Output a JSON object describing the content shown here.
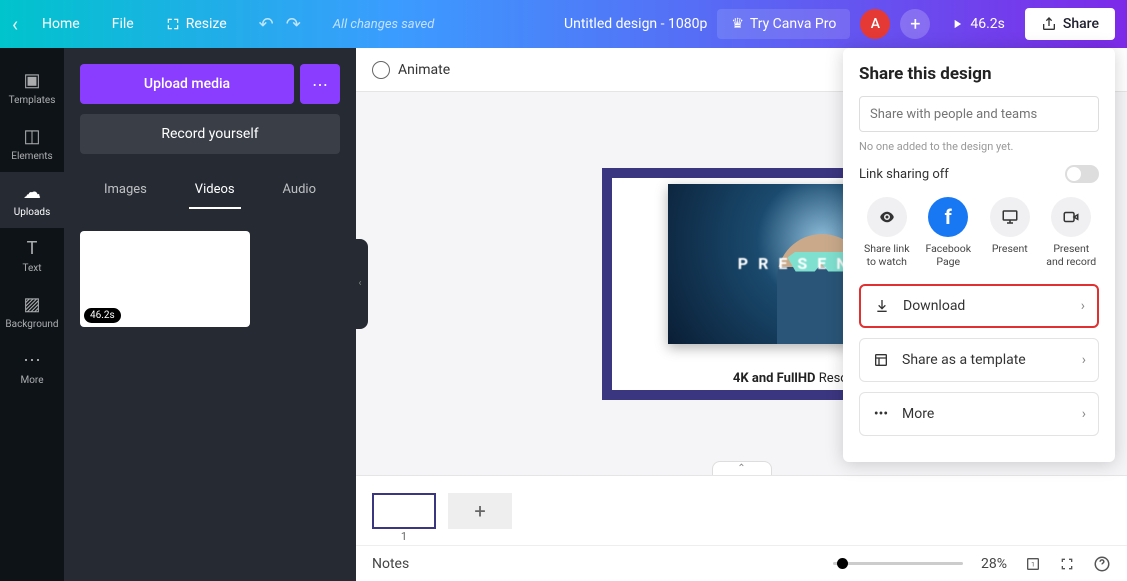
{
  "topbar": {
    "home": "Home",
    "file": "File",
    "resize": "Resize",
    "saved": "All changes saved",
    "doc_title": "Untitled design - 1080p",
    "try_pro": "Try Canva Pro",
    "avatar_letter": "A",
    "play_time": "46.2s",
    "share": "Share"
  },
  "rail": {
    "templates": "Templates",
    "elements": "Elements",
    "uploads": "Uploads",
    "text": "Text",
    "background": "Background",
    "more": "More"
  },
  "sidepanel": {
    "upload": "Upload media",
    "record": "Record yourself",
    "tab_images": "Images",
    "tab_videos": "Videos",
    "tab_audio": "Audio",
    "thumb_duration": "46.2s"
  },
  "canvas": {
    "animate": "Animate",
    "slide_present": "PRESENT",
    "resolution_bold": "4K and FullHD",
    "resolution_rest": " Resolution",
    "page_number": "1"
  },
  "bottom": {
    "notes": "Notes",
    "zoom": "28%"
  },
  "share": {
    "title": "Share this design",
    "input_placeholder": "Share with people and teams",
    "hint": "No one added to the design yet.",
    "link_label": "Link sharing off",
    "opt_watch": "Share link to watch",
    "opt_fb": "Facebook Page",
    "opt_present": "Present",
    "opt_rec": "Present and record",
    "download": "Download",
    "template": "Share as a template",
    "more": "More"
  }
}
